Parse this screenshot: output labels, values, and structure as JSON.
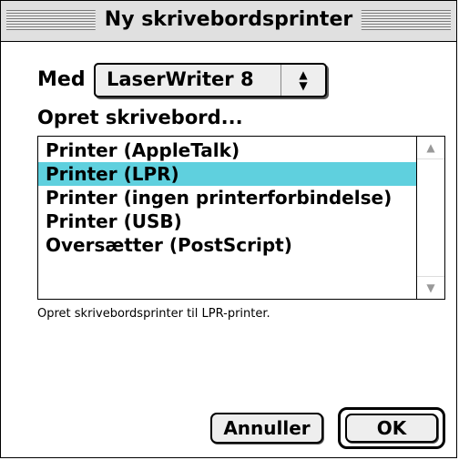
{
  "window": {
    "title": "Ny skrivebordsprinter"
  },
  "med": {
    "label": "Med",
    "selected": "LaserWriter 8",
    "arrow_icon": "updown-arrows-icon"
  },
  "create_label": "Opret skrivebord...",
  "list": {
    "items": [
      {
        "label": "Printer (AppleTalk)",
        "selected": false
      },
      {
        "label": "Printer (LPR)",
        "selected": true
      },
      {
        "label": "Printer (ingen printerforbindelse)",
        "selected": false
      },
      {
        "label": "Printer (USB)",
        "selected": false
      },
      {
        "label": "Oversætter (PostScript)",
        "selected": false
      }
    ],
    "selection_color": "#5fd0de"
  },
  "description": "Opret skrivebordsprinter til LPR-printer.",
  "buttons": {
    "cancel": "Annuller",
    "ok": "OK"
  }
}
